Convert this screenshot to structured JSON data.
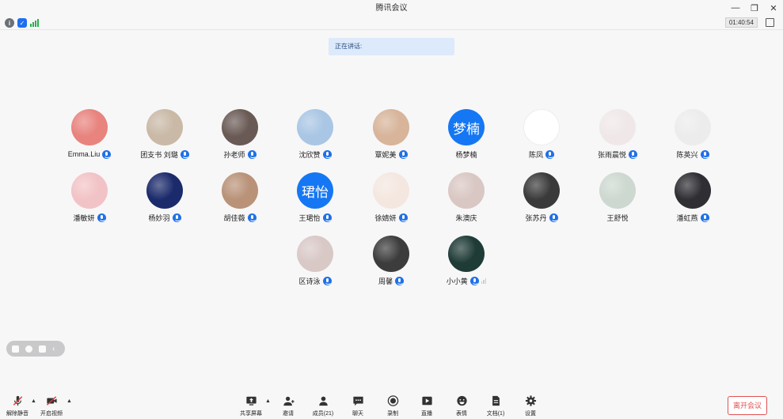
{
  "window": {
    "title": "腾讯会议",
    "controls": [
      "—",
      "❐",
      "✕"
    ]
  },
  "status": {
    "timer": "01:40:54"
  },
  "speaking_banner": "正在讲话:",
  "participants": [
    {
      "name": "Emma.Liu",
      "avatar": "photo",
      "color": "#e8837e",
      "mic": true
    },
    {
      "name": "团支书 刘璐",
      "avatar": "photo",
      "color": "#c9b9a6",
      "mic": true
    },
    {
      "name": "孙老师",
      "avatar": "photo",
      "color": "#6a5a55",
      "mic": true
    },
    {
      "name": "沈欣赞",
      "avatar": "photo",
      "color": "#a9c6e4",
      "mic": true
    },
    {
      "name": "覃妮美",
      "avatar": "photo",
      "color": "#d7b49a",
      "mic": true
    },
    {
      "name": "杨梦楠",
      "avatar": "text",
      "avatar_text": "梦楠",
      "color": "#1577f3",
      "mic": false
    },
    {
      "name": "陈凤",
      "avatar": "photo",
      "color": "#ffffff",
      "mic": true
    },
    {
      "name": "张雨晨悦",
      "avatar": "photo",
      "color": "#f0e8e8",
      "mic": true
    },
    {
      "name": "陈英兴",
      "avatar": "photo",
      "color": "#ececec",
      "mic": true
    },
    {
      "name": "潘敏妍",
      "avatar": "photo",
      "color": "#f2c3c6",
      "mic": true
    },
    {
      "name": "杨妙羽",
      "avatar": "photo",
      "color": "#1b2a6b",
      "mic": true
    },
    {
      "name": "胡佳薇",
      "avatar": "photo",
      "color": "#b99278",
      "mic": true
    },
    {
      "name": "王珺怡",
      "avatar": "text",
      "avatar_text": "珺怡",
      "color": "#1577f3",
      "mic": true
    },
    {
      "name": "徐婧妍",
      "avatar": "photo",
      "color": "#f4e7e0",
      "mic": true
    },
    {
      "name": "朱澳庆",
      "avatar": "photo",
      "color": "#d9c7c3",
      "mic": false
    },
    {
      "name": "张苏丹",
      "avatar": "photo",
      "color": "#3a3a3a",
      "mic": true
    },
    {
      "name": "王舒悦",
      "avatar": "photo",
      "color": "#cdd8d0",
      "mic": false
    },
    {
      "name": "潘虹燕",
      "avatar": "photo",
      "color": "#2e2e33",
      "mic": true
    },
    {
      "name": "区诗泳",
      "avatar": "photo",
      "color": "#d8c8c6",
      "mic": true
    },
    {
      "name": "周馨",
      "avatar": "photo",
      "color": "#3c3c3c",
      "mic": true
    },
    {
      "name": "小小黄",
      "avatar": "photo",
      "color": "#1f3b36",
      "mic": true,
      "level": true
    }
  ],
  "toolbar": {
    "mute": "解除静音",
    "video": "开启视频",
    "share": "共享屏幕",
    "invite": "邀请",
    "members": "成员(21)",
    "chat": "聊天",
    "record": "录制",
    "live": "直播",
    "reaction": "表情",
    "docs": "文档(1)",
    "settings": "设置",
    "leave": "离开会议"
  }
}
